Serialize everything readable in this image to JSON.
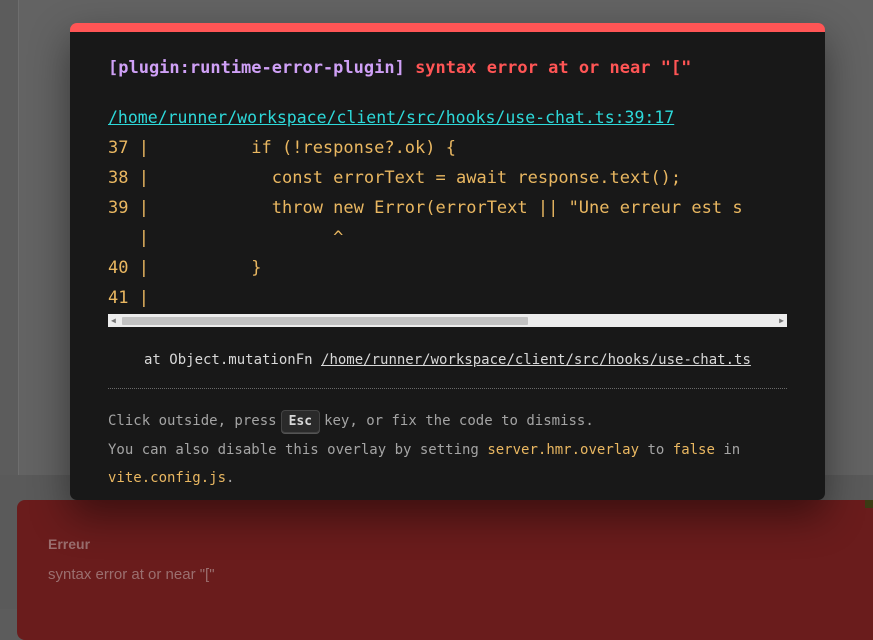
{
  "overlay": {
    "plugin": "[plugin:runtime-error-plugin]",
    "message": "syntax error at or near \"[\"",
    "file": "/home/runner/workspace/client/src/hooks/use-chat.ts:39:17",
    "frame": [
      "37 |          if (!response?.ok) {",
      "38 |            const errorText = await response.text();",
      "39 |            throw new Error(errorText || \"Une erreur est s",
      "   |                  ^",
      "40 |          }",
      "41 |"
    ],
    "stack_prefix": "at Object.mutationFn ",
    "stack_file": "/home/runner/workspace/client/src/hooks/use-chat.ts",
    "tip_line1_a": "Click outside, press",
    "tip_key": "Esc",
    "tip_line1_b": "key, or fix the code to dismiss.",
    "tip_line2_a": "You can also disable this overlay by setting",
    "tip_setting": "server.hmr.overlay",
    "tip_line2_b": "to",
    "tip_false": "false",
    "tip_line2_c": "in",
    "tip_config": "vite.config.js",
    "tip_end": "."
  },
  "toast": {
    "title": "Erreur",
    "message": "syntax error at or near \"[\""
  },
  "colors": {
    "accent_red": "#ff5555",
    "plugin_purple": "#cfa0f6",
    "link_cyan": "#2dd9da",
    "code_yellow": "#e9b761",
    "toast_red": "#6a1c1c"
  }
}
